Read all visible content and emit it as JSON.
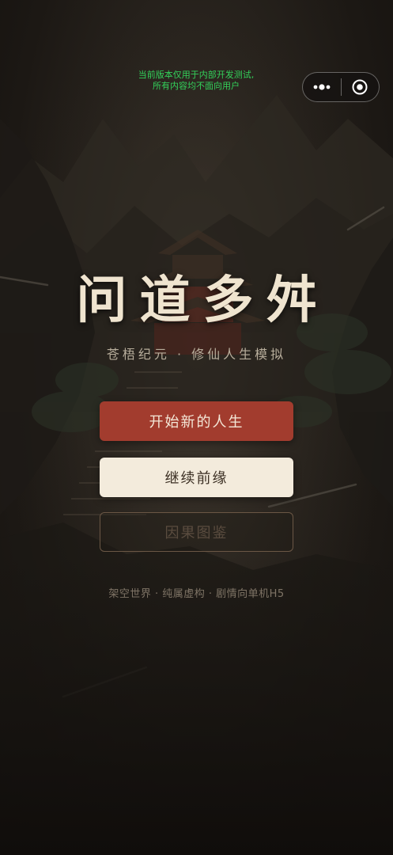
{
  "dev_notice": {
    "line1": "当前版本仅用于内部开发测试,",
    "line2": "所有内容均不面向用户"
  },
  "capsule": {
    "more_icon": "more-dots-icon",
    "close_icon": "target-circle-icon"
  },
  "title": "问道多舛",
  "subtitle": "苍梧纪元 · 修仙人生模拟",
  "buttons": {
    "start": "开始新的人生",
    "continue": "继续前缘",
    "gallery": "因果图鉴"
  },
  "footer": "架空世界 · 纯属虚构 · 剧情向单机H5",
  "colors": {
    "accent_red": "#a23c2e",
    "cream": "#f3ebdc",
    "title_text": "#efe4cf",
    "notice_green": "#33d15a"
  }
}
